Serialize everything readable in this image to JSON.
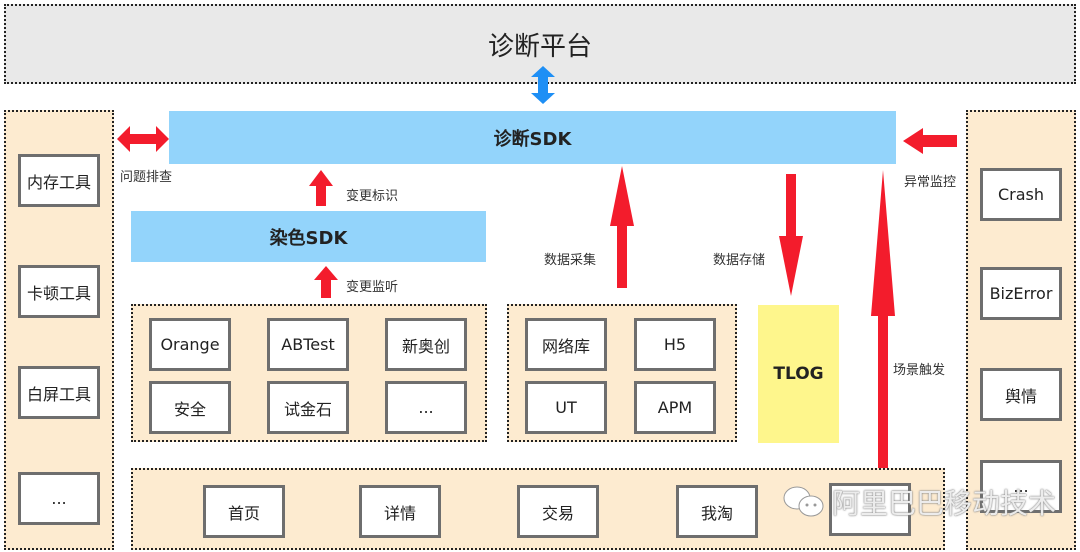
{
  "platform": {
    "title": "诊断平台"
  },
  "diag_sdk": {
    "label": "诊断SDK"
  },
  "dye_sdk": {
    "label": "染色SDK"
  },
  "left_panel": {
    "items": [
      "内存工具",
      "卡顿工具",
      "白屏工具",
      "..."
    ]
  },
  "right_panel": {
    "items": [
      "Crash",
      "BizError",
      "舆情",
      "..."
    ]
  },
  "config_group": {
    "items": [
      "Orange",
      "ABTest",
      "新奥创",
      "安全",
      "试金石",
      "..."
    ]
  },
  "collect_group": {
    "items": [
      "网络库",
      "H5",
      "UT",
      "APM"
    ]
  },
  "tlog": {
    "label": "TLOG"
  },
  "pages_group": {
    "items": [
      "首页",
      "详情",
      "交易",
      "我淘",
      ""
    ]
  },
  "arrow_labels": {
    "troubleshoot": "问题排查",
    "change_mark": "变更标识",
    "change_listen": "变更监听",
    "data_collect": "数据采集",
    "data_store": "数据存储",
    "exception_monitor": "异常监控",
    "scene_trigger": "场景触发"
  },
  "colors": {
    "arrow_red": "#f31c2c",
    "arrow_blue": "#1e8ff5",
    "sdk_blue": "#93d4fb",
    "panel_bg": "#fdebd0",
    "tlog_yellow": "#fef68c",
    "platform_gray": "#e9e9e9"
  },
  "watermark": {
    "text": "阿里巴巴移动技术"
  }
}
